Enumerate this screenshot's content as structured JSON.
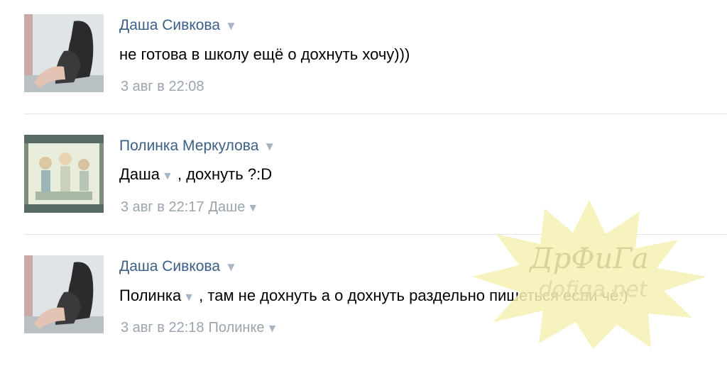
{
  "posts": [
    {
      "author": "Даша Сивкова",
      "text": "не готова в школу ещё о дохнуть хочу)))",
      "time": "3 авг в 22:08"
    },
    {
      "author": "Полинка Меркулова",
      "mention": "Даша",
      "text_after": ", дохнуть ?:D",
      "time": "3 авг в 22:17",
      "reply_to": "Даше"
    },
    {
      "author": "Даша Сивкова",
      "mention": "Полинка",
      "text_after": ", там не дохнуть а о дохнуть раздельно пишеться если чё:)",
      "time": "3 авг в 22:18",
      "reply_to": "Полинке"
    }
  ],
  "watermark": {
    "title": "ДрФиГа",
    "site": "dofiga.net"
  },
  "colors": {
    "author": "#3b5f86",
    "meta": "#9aa4ae",
    "divider": "#dfe3e8",
    "watermark": "#f1ee9c"
  },
  "icons": {
    "dropdown": "triangle-down-icon"
  }
}
